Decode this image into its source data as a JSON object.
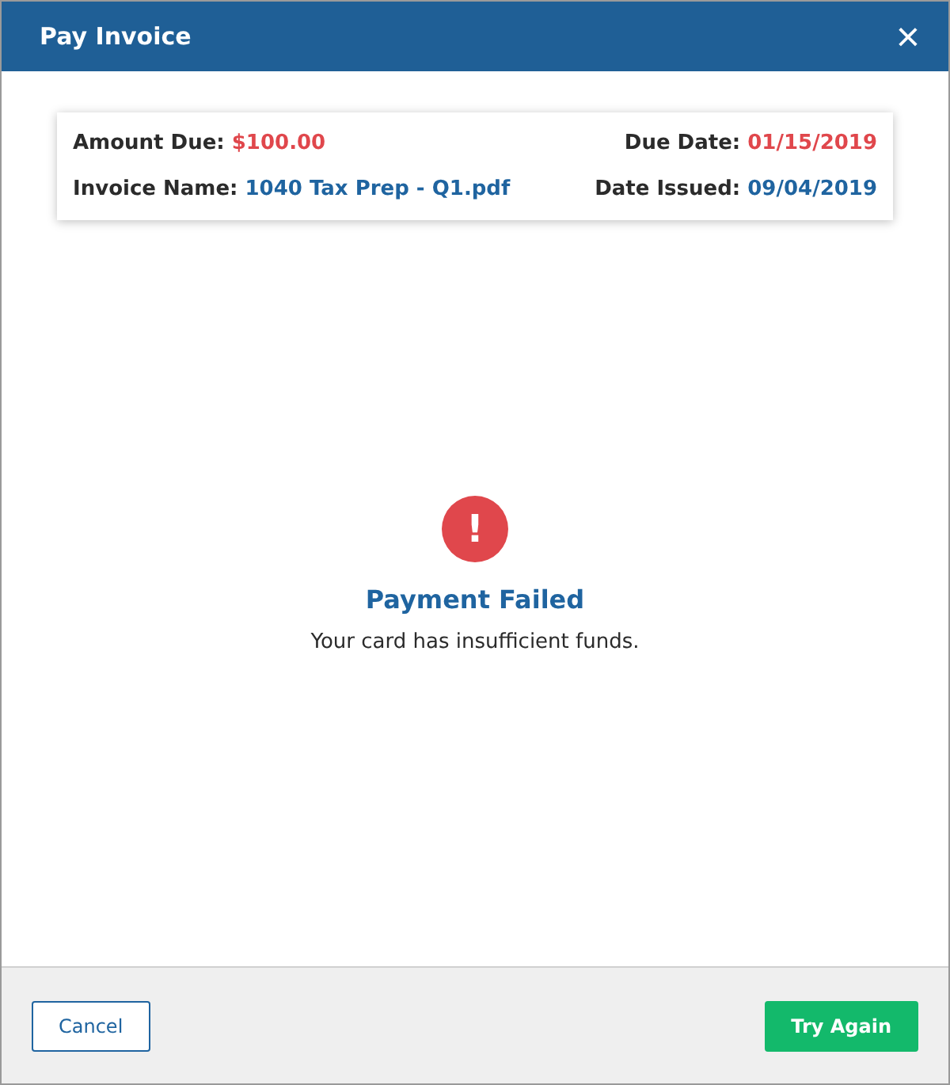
{
  "window": {
    "title": "Pay Invoice",
    "close": "×"
  },
  "invoice": [
    {
      "label": "Amount Due:",
      "value": "$100.00",
      "color": "#e0474c"
    },
    {
      "label": "Due Date:",
      "value": "01/15/2019",
      "color": "#e0474c"
    },
    {
      "label": "Invoice Name:",
      "value": "1040 Tax Prep - Q1.pdf",
      "color": "#1f64a0"
    },
    {
      "label": "Date Issued:",
      "value": "09/04/2019",
      "color": "#1f64a0"
    }
  ],
  "status": {
    "icon": "!",
    "title": "Payment Failed",
    "message": "Your card has insufficient funds."
  },
  "buttons": [
    {
      "label": "Cancel",
      "kind": "secondary"
    },
    {
      "label": "Try Again",
      "kind": "primary"
    }
  ]
}
